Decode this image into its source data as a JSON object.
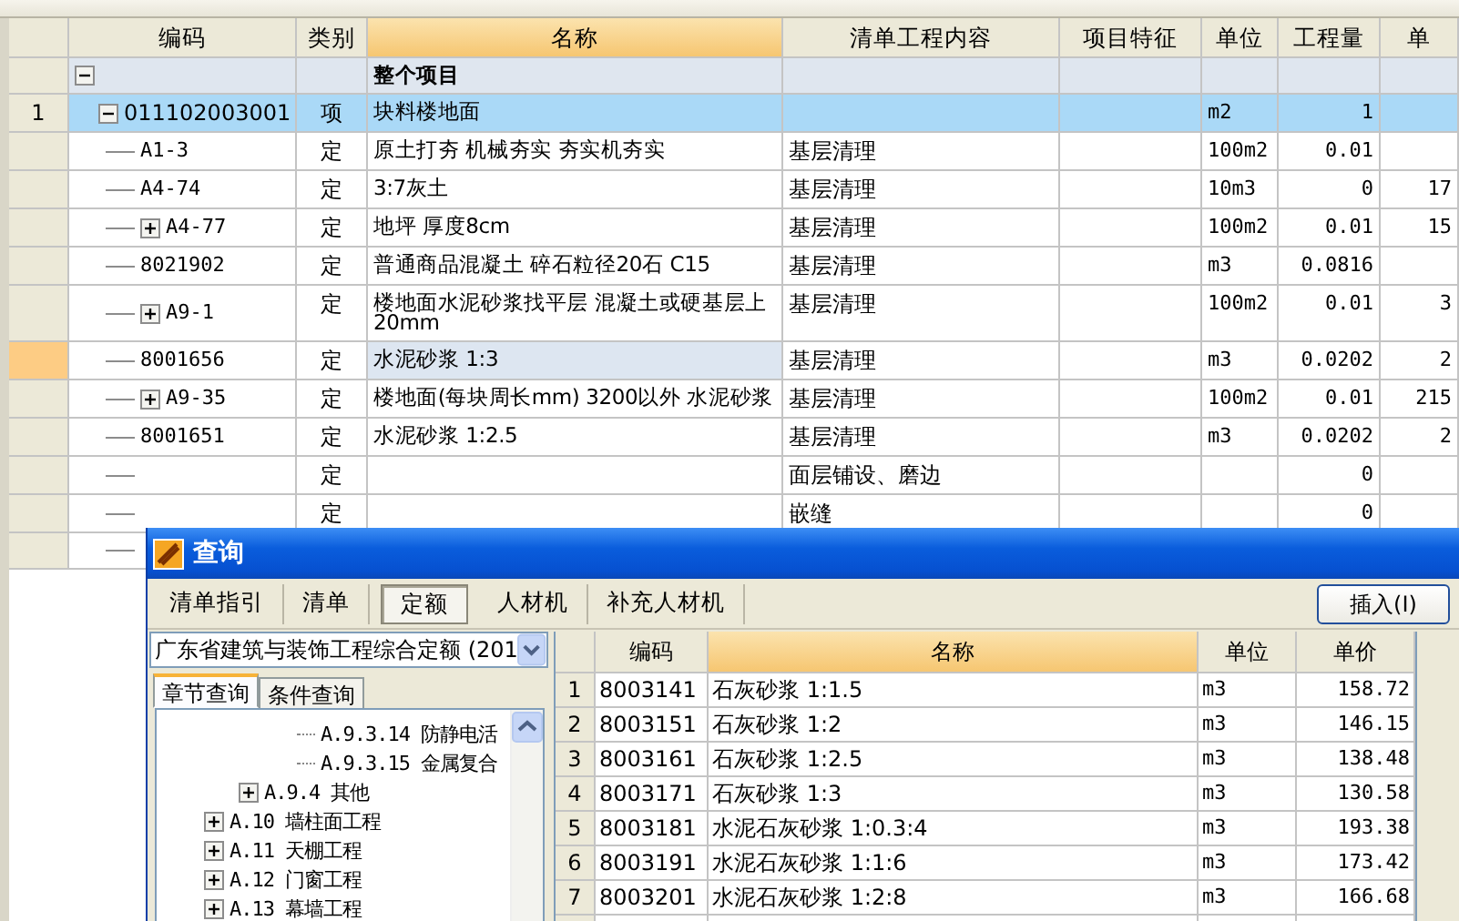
{
  "main_table": {
    "columns": [
      "编码",
      "类别",
      "名称",
      "清单工程内容",
      "项目特征",
      "单位",
      "工程量",
      "单"
    ],
    "rows": [
      {
        "kind": "group",
        "name": "整个项目",
        "expanded": true,
        "selected": false,
        "current": false,
        "children": [
          {
            "kind": "item",
            "number": "1",
            "code": "011102003001",
            "type": "项",
            "name": "块料楼地面",
            "unit": "m2",
            "quantity": "1",
            "expanded": true,
            "selected": true,
            "current": false,
            "children": [
              {
                "kind": "item",
                "code": "A1-3",
                "type": "定",
                "name": "原土打夯 机械夯实 夯实机夯实",
                "content": "基层清理",
                "unit": "100m2",
                "quantity": "0.01",
                "selected": false,
                "current": false
              },
              {
                "kind": "item",
                "code": "A4-74",
                "type": "定",
                "name": "3:7灰土",
                "content": "基层清理",
                "unit": "10m3",
                "quantity": "0",
                "price": "17",
                "selected": false,
                "current": false
              },
              {
                "kind": "item",
                "code": "A4-77",
                "type": "定",
                "name": "地坪 厚度8cm",
                "content": "基层清理",
                "unit": "100m2",
                "quantity": "0.01",
                "price": "15",
                "expanded": false,
                "selected": false,
                "current": false
              },
              {
                "kind": "item",
                "code": "8021902",
                "type": "定",
                "name": "普通商品混凝土 碎石粒径20石 C15",
                "content": "基层清理",
                "unit": "m3",
                "quantity": "0.0816",
                "selected": false,
                "current": false
              },
              {
                "kind": "item",
                "code": "A9-1",
                "type": "定",
                "name": "楼地面水泥砂浆找平层 混凝土或硬基层上 20mm",
                "content": "基层清理",
                "unit": "100m2",
                "quantity": "0.01",
                "price": "3",
                "expanded": false,
                "selected": false,
                "current": false
              },
              {
                "kind": "item",
                "code": "8001656",
                "type": "定",
                "name": "水泥砂浆 1:3",
                "content": "基层清理",
                "unit": "m3",
                "quantity": "0.0202",
                "price": "2",
                "selected": false,
                "current": true
              },
              {
                "kind": "item",
                "code": "A9-35",
                "type": "定",
                "name": "楼地面(每块周长mm) 3200以外 水泥砂浆",
                "content": "基层清理",
                "unit": "100m2",
                "quantity": "0.01",
                "price": "215",
                "expanded": false,
                "selected": false,
                "current": false
              },
              {
                "kind": "item",
                "code": "8001651",
                "type": "定",
                "name": "水泥砂浆 1:2.5",
                "content": "基层清理",
                "unit": "m3",
                "quantity": "0.0202",
                "price": "2",
                "selected": false,
                "current": false
              },
              {
                "kind": "item",
                "type": "定",
                "content": "面层铺设、磨边",
                "quantity": "0",
                "selected": false,
                "current": false
              },
              {
                "kind": "item",
                "type": "定",
                "content": "嵌缝",
                "quantity": "0",
                "selected": false,
                "current": false
              },
              {
                "kind": "item",
                "selected": false,
                "current": false
              }
            ]
          }
        ]
      }
    ]
  },
  "dialog": {
    "title": "查询",
    "tabs": [
      {
        "label": "清单指引",
        "selected": false
      },
      {
        "label": "清单",
        "selected": false
      },
      {
        "label": "定额",
        "selected": true
      },
      {
        "label": "人材机",
        "selected": false
      },
      {
        "label": "补充人材机",
        "selected": false
      }
    ],
    "insert_button": "插入(I)",
    "library_select": {
      "value": "广东省建筑与装饰工程综合定额 (201"
    },
    "search_tabs": [
      {
        "label": "章节查询",
        "selected": true
      },
      {
        "label": "条件查询",
        "selected": false
      }
    ],
    "tree": [
      {
        "children": [
          {
            "children": [
              {
                "label": "A.9.3.14 防静电活"
              },
              {
                "label": "A.9.3.15 金属复合"
              }
            ]
          },
          {
            "label": "A.9.4 其他",
            "expanded": false
          }
        ]
      },
      {
        "label": "A.10 墙柱面工程",
        "expanded": false
      },
      {
        "label": "A.11 天棚工程",
        "expanded": false
      },
      {
        "label": "A.12 门窗工程",
        "expanded": false
      },
      {
        "label": "A.13 幕墙工程",
        "expanded": false
      }
    ],
    "results": {
      "columns": [
        "编码",
        "名称",
        "单位",
        "单价"
      ],
      "rows": [
        {
          "number": "1",
          "code": "8003141",
          "name": "石灰砂浆 1:1.5",
          "unit": "m3",
          "price": "158.72"
        },
        {
          "number": "2",
          "code": "8003151",
          "name": "石灰砂浆 1:2",
          "unit": "m3",
          "price": "146.15"
        },
        {
          "number": "3",
          "code": "8003161",
          "name": "石灰砂浆 1:2.5",
          "unit": "m3",
          "price": "138.48"
        },
        {
          "number": "4",
          "code": "8003171",
          "name": "石灰砂浆 1:3",
          "unit": "m3",
          "price": "130.58"
        },
        {
          "number": "5",
          "code": "8003181",
          "name": "水泥石灰砂浆 1:0.3:4",
          "unit": "m3",
          "price": "193.38"
        },
        {
          "number": "6",
          "code": "8003191",
          "name": "水泥石灰砂浆 1:1:6",
          "unit": "m3",
          "price": "173.42"
        },
        {
          "number": "7",
          "code": "8003201",
          "name": "水泥石灰砂浆 1:2:8",
          "unit": "m3",
          "price": "166.68"
        }
      ]
    }
  }
}
